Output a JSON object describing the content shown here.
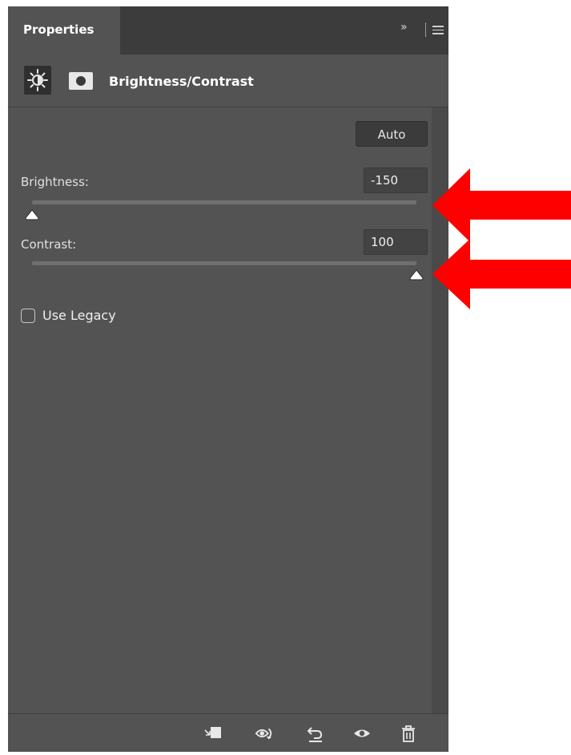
{
  "panel": {
    "tab_label": "Properties",
    "collapse_label": "»"
  },
  "header": {
    "title": "Brightness/Contrast",
    "icons": [
      "brightness-contrast-icon",
      "layer-mask-icon"
    ]
  },
  "controls": {
    "auto_label": "Auto",
    "brightness": {
      "label": "Brightness:",
      "value": "-150",
      "min": -150,
      "max": 150
    },
    "contrast": {
      "label": "Contrast:",
      "value": "100",
      "min": -50,
      "max": 100
    },
    "legacy": {
      "label": "Use Legacy",
      "checked": false
    }
  },
  "footer": {
    "icons": [
      "clip-to-layer-icon",
      "view-previous-state-icon",
      "reset-icon",
      "toggle-visibility-icon",
      "delete-icon"
    ]
  },
  "annotations": {
    "arrow_color": "#ff0000",
    "arrows": [
      "brightness-arrow",
      "contrast-arrow"
    ]
  },
  "colors": {
    "panel_bg": "#535353",
    "tab_bar_bg": "#3c3c3c",
    "field_bg": "#434343",
    "text": "#dcdcdc"
  }
}
